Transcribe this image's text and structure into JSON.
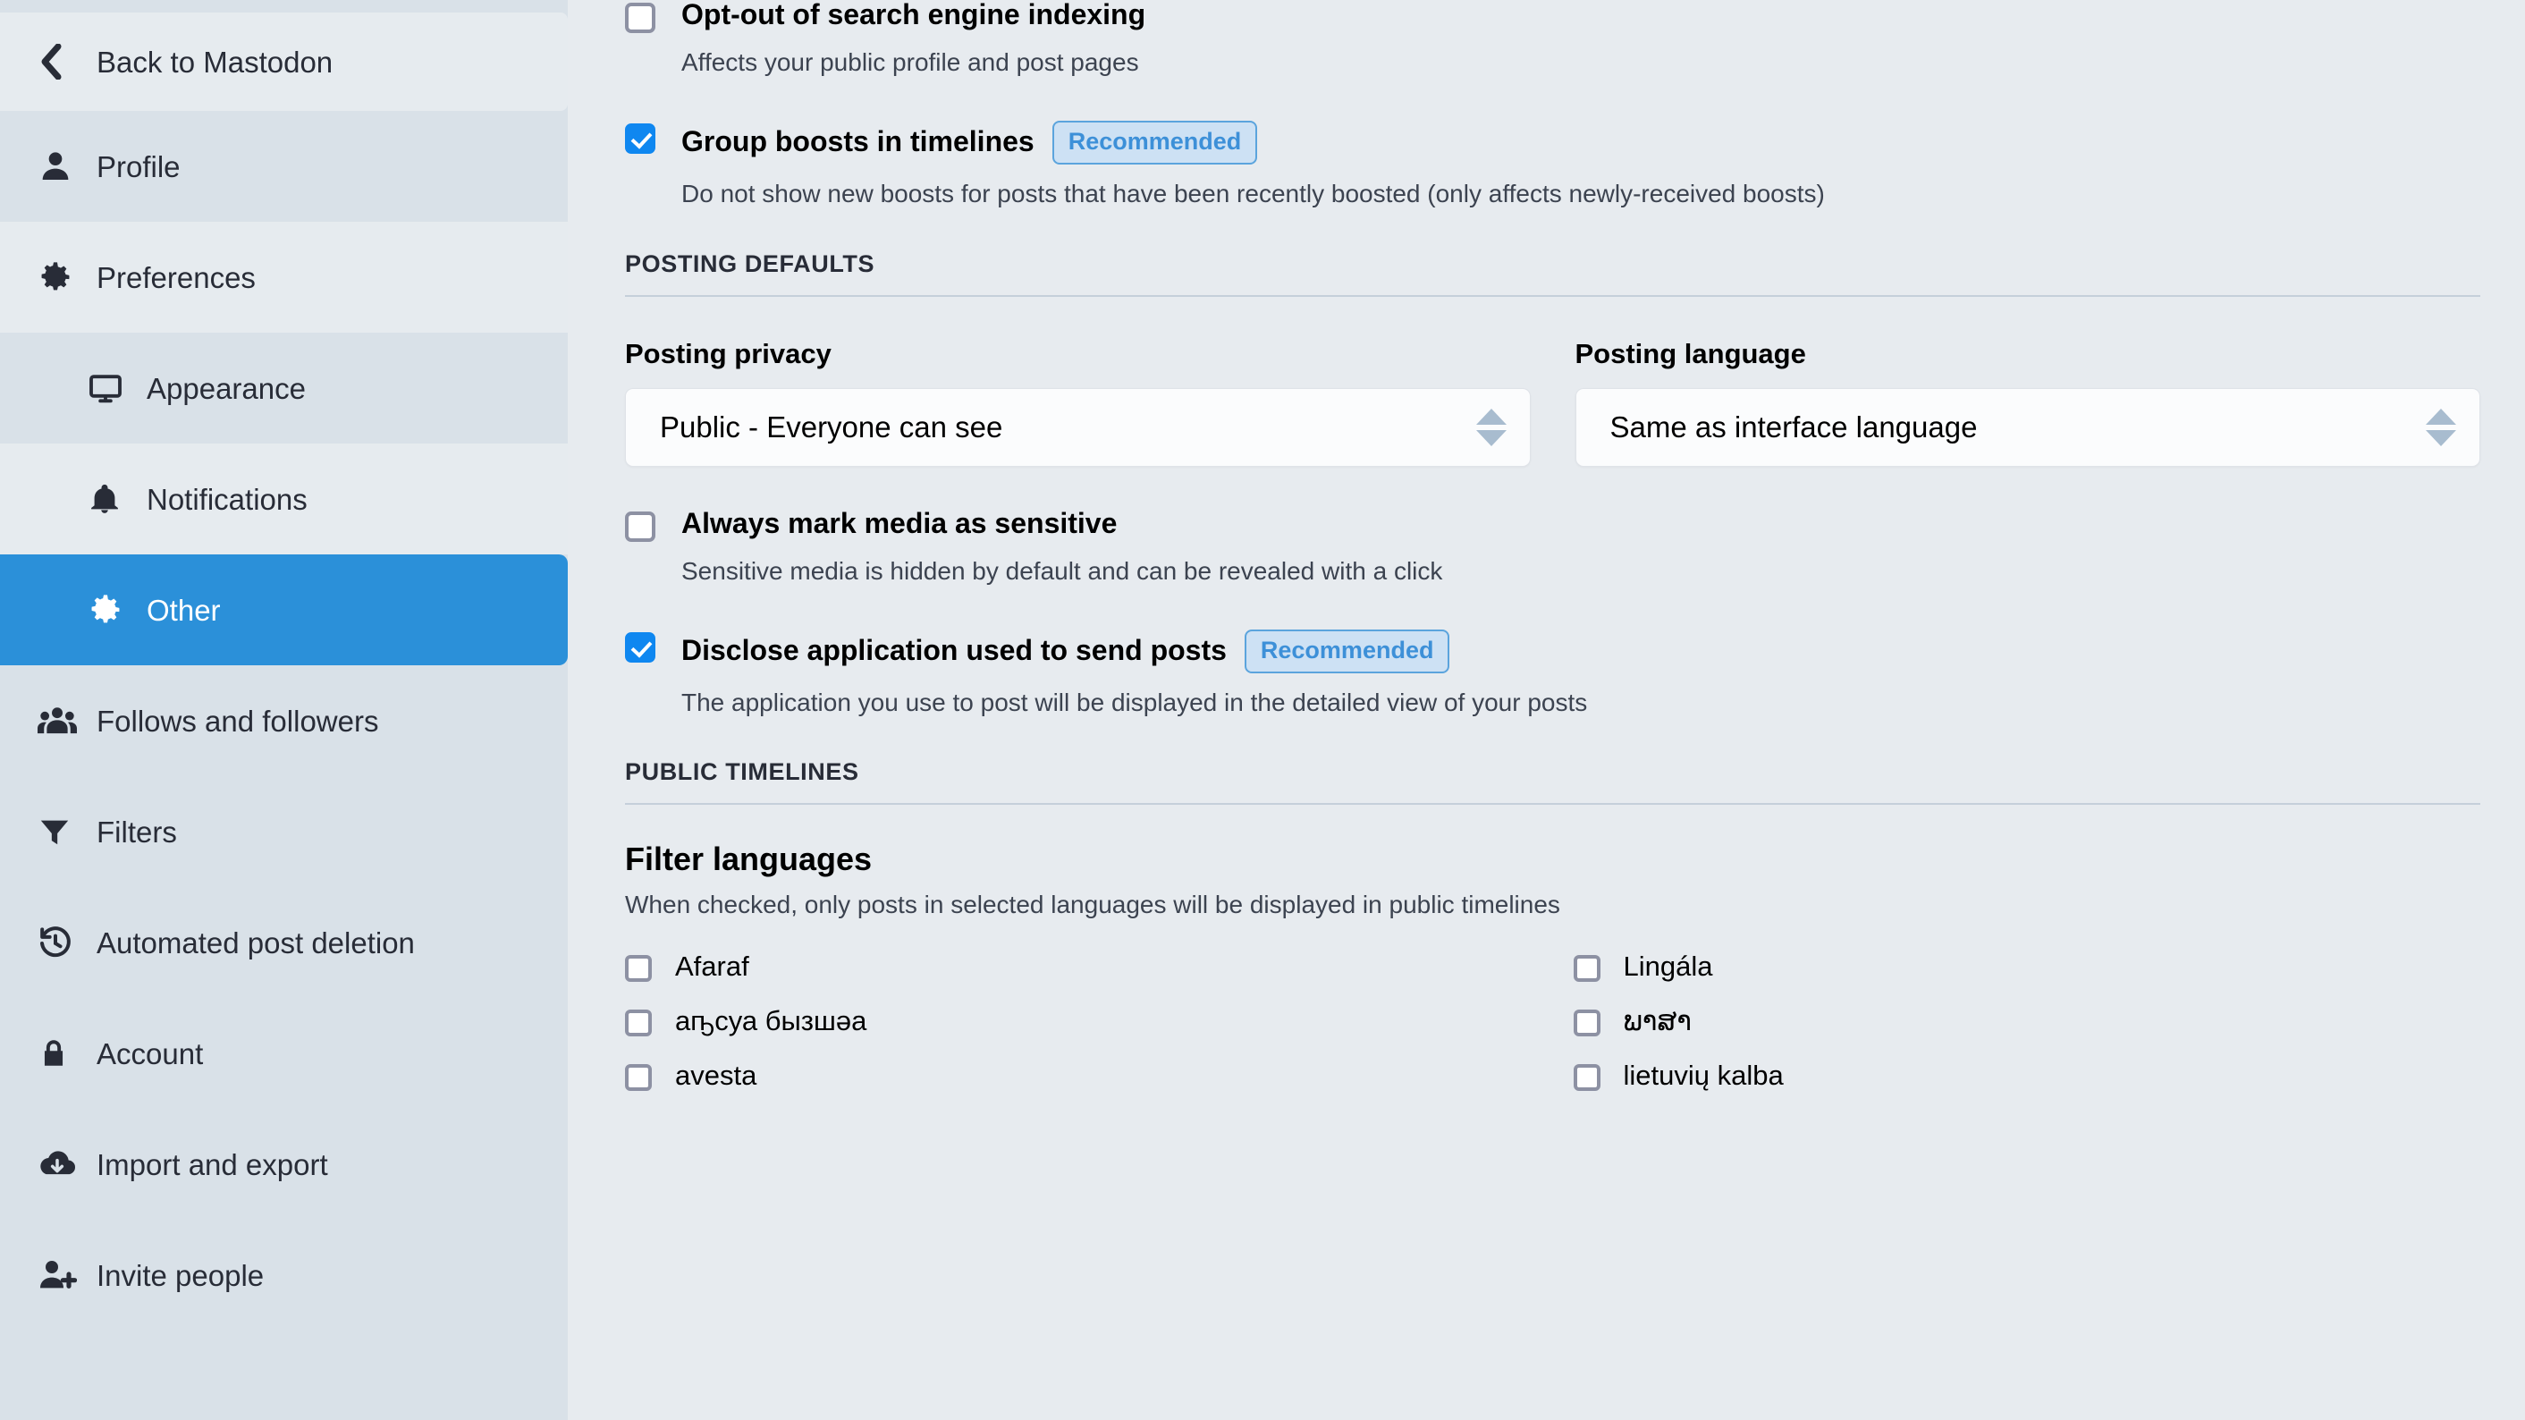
{
  "sidebar": {
    "back": {
      "label": "Back to Mastodon",
      "icon": "chevron-left-icon"
    },
    "items": [
      {
        "label": "Profile",
        "icon": "person-icon",
        "level": "top",
        "active": false,
        "alt": false
      },
      {
        "label": "Preferences",
        "icon": "gear-icon",
        "level": "top",
        "active": false,
        "alt": true
      },
      {
        "label": "Appearance",
        "icon": "monitor-icon",
        "level": "sub",
        "active": false,
        "alt": false
      },
      {
        "label": "Notifications",
        "icon": "bell-icon",
        "level": "sub",
        "active": false,
        "alt": true
      },
      {
        "label": "Other",
        "icon": "gear-icon",
        "level": "sub",
        "active": true,
        "alt": false
      },
      {
        "label": "Follows and followers",
        "icon": "users-icon",
        "level": "top",
        "active": false,
        "alt": false
      },
      {
        "label": "Filters",
        "icon": "funnel-icon",
        "level": "top",
        "active": false,
        "alt": false
      },
      {
        "label": "Automated post deletion",
        "icon": "history-icon",
        "level": "top",
        "active": false,
        "alt": false
      },
      {
        "label": "Account",
        "icon": "lock-icon",
        "level": "top",
        "active": false,
        "alt": false
      },
      {
        "label": "Import and export",
        "icon": "cloud-download-icon",
        "level": "top",
        "active": false,
        "alt": false
      },
      {
        "label": "Invite people",
        "icon": "person-add-icon",
        "level": "top",
        "active": false,
        "alt": false
      }
    ]
  },
  "main": {
    "options_top": [
      {
        "title": "Opt-out of search engine indexing",
        "hint": "Affects your public profile and post pages",
        "checked": false,
        "badge": ""
      },
      {
        "title": "Group boosts in timelines",
        "hint": "Do not show new boosts for posts that have been recently boosted (only affects newly-received boosts)",
        "checked": true,
        "badge": "Recommended"
      }
    ],
    "posting_defaults": {
      "section_label": "POSTING DEFAULTS",
      "privacy": {
        "label": "Posting privacy",
        "value": "Public - Everyone can see"
      },
      "language": {
        "label": "Posting language",
        "value": "Same as interface language"
      },
      "options": [
        {
          "title": "Always mark media as sensitive",
          "hint": "Sensitive media is hidden by default and can be revealed with a click",
          "checked": false,
          "badge": ""
        },
        {
          "title": "Disclose application used to send posts",
          "hint": "The application you use to post will be displayed in the detailed view of your posts",
          "checked": true,
          "badge": "Recommended"
        }
      ]
    },
    "public_timelines": {
      "section_label": "PUBLIC TIMELINES",
      "filter_title": "Filter languages",
      "filter_desc": "When checked, only posts in selected languages will be displayed in public timelines",
      "languages_left": [
        {
          "label": "Afaraf",
          "checked": false
        },
        {
          "label": "аҧсуа бызшәа",
          "checked": false
        },
        {
          "label": "avesta",
          "checked": false
        }
      ],
      "languages_right": [
        {
          "label": "Lingála",
          "checked": false
        },
        {
          "label": "ພາສາ",
          "checked": false
        },
        {
          "label": "lietuvių kalba",
          "checked": false
        }
      ]
    }
  },
  "colors": {
    "accent": "#2b90d9",
    "checkbox_checked": "#0f87f0",
    "badge_text": "#3d90d8",
    "badge_bg": "#cde1f4",
    "sidebar_bg": "#d9e1e8",
    "main_bg": "#e7ebef"
  }
}
